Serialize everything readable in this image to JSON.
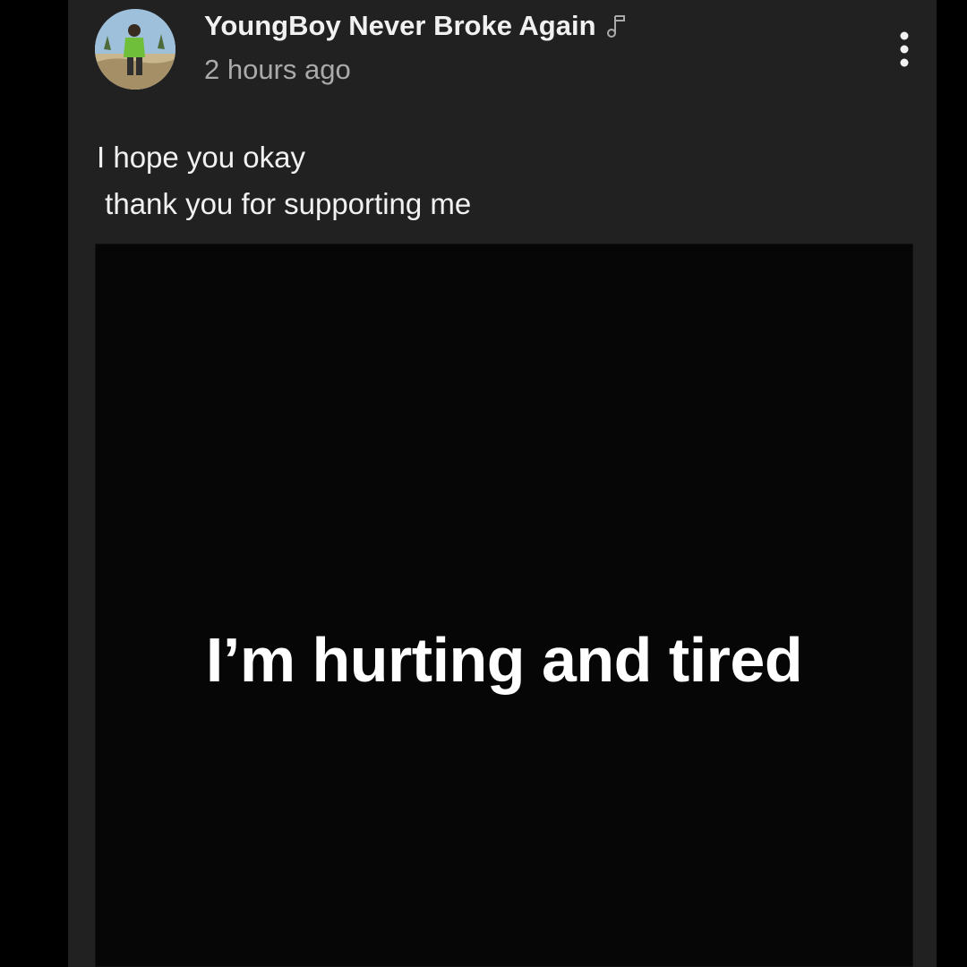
{
  "post": {
    "author": "YoungBoy Never Broke Again",
    "author_badge_icon": "music-note-icon",
    "timestamp": "2 hours ago",
    "menu_icon": "more-options-icon",
    "text_line_1": "I hope you okay",
    "text_line_2": " thank you for supporting me",
    "image_text": "I’m hurting and tired"
  },
  "colors": {
    "page_background": "#000000",
    "card_background": "#212121",
    "primary_text": "#f1f1f1",
    "secondary_text": "#aaaaaa",
    "image_background": "#060606"
  }
}
